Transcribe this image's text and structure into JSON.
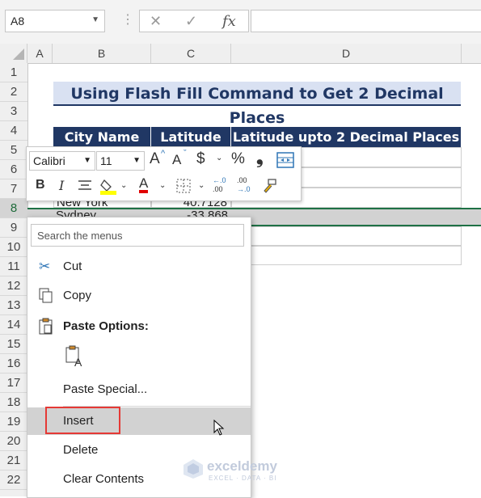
{
  "formula_bar": {
    "name_box": "A8",
    "cancel": "✕",
    "enter": "✓",
    "fx": "fx"
  },
  "columns": [
    "A",
    "B",
    "C",
    "D"
  ],
  "rows": [
    "1",
    "2",
    "3",
    "4",
    "5",
    "6",
    "7",
    "8",
    "9",
    "10",
    "11",
    "12",
    "13",
    "14",
    "15",
    "16",
    "17",
    "18",
    "19",
    "20",
    "21",
    "22"
  ],
  "sheet": {
    "title": "Using Flash Fill Command to Get 2 Decimal Places",
    "headers": [
      "City Name",
      "Latitude",
      "Latitude upto 2 Decimal Places"
    ],
    "visible_row_text": {
      "city": "Sydney",
      "latitude": "-33.868"
    },
    "partial_row_text": {
      "city": "New York",
      "latitude": "40.7128"
    }
  },
  "mini_toolbar": {
    "font": "Calibri",
    "size": "11",
    "grow": "A",
    "shrink": "A",
    "currency": "$",
    "percent": "%",
    "comma": "❟",
    "bold": "B",
    "italic": "I",
    "font_color": "A",
    "inc_decimal_top": "←.0",
    "inc_decimal_bot": ".00",
    "dec_decimal_top": ".00",
    "dec_decimal_bot": "→.0"
  },
  "context_menu": {
    "search_placeholder": "Search the menus",
    "cut": "Cut",
    "copy": "Copy",
    "paste_options": "Paste Options:",
    "paste_special": "Paste Special...",
    "insert": "Insert",
    "delete": "Delete",
    "clear_contents": "Clear Contents"
  },
  "watermark": {
    "name": "exceldemy",
    "tagline": "EXCEL · DATA · BI"
  },
  "colors": {
    "header_fill": "#203764",
    "title_fill": "#d9e1f2",
    "selection": "#1e7145",
    "highlight_box": "#e53935"
  }
}
